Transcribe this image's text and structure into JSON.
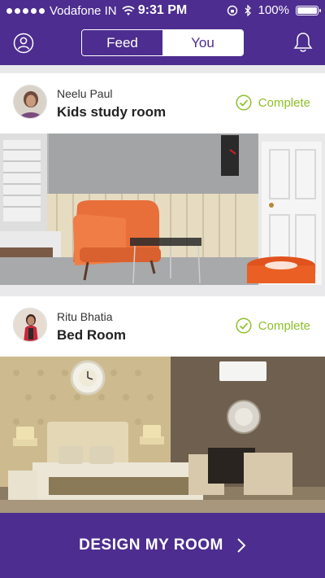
{
  "status_bar": {
    "carrier": "Vodafone IN",
    "time": "9:31 PM",
    "battery": "100%"
  },
  "nav": {
    "tabs": [
      {
        "label": "Feed",
        "active": true
      },
      {
        "label": "You",
        "active": false
      }
    ]
  },
  "feed": [
    {
      "user": "Neelu Paul",
      "room": "Kids study room",
      "status": "Complete"
    },
    {
      "user": "Ritu Bhatia",
      "room": "Bed Room",
      "status": "Complete"
    }
  ],
  "cta": {
    "label": "DESIGN MY ROOM"
  },
  "colors": {
    "brand": "#4d2d8f",
    "complete": "#8fbf2a"
  }
}
